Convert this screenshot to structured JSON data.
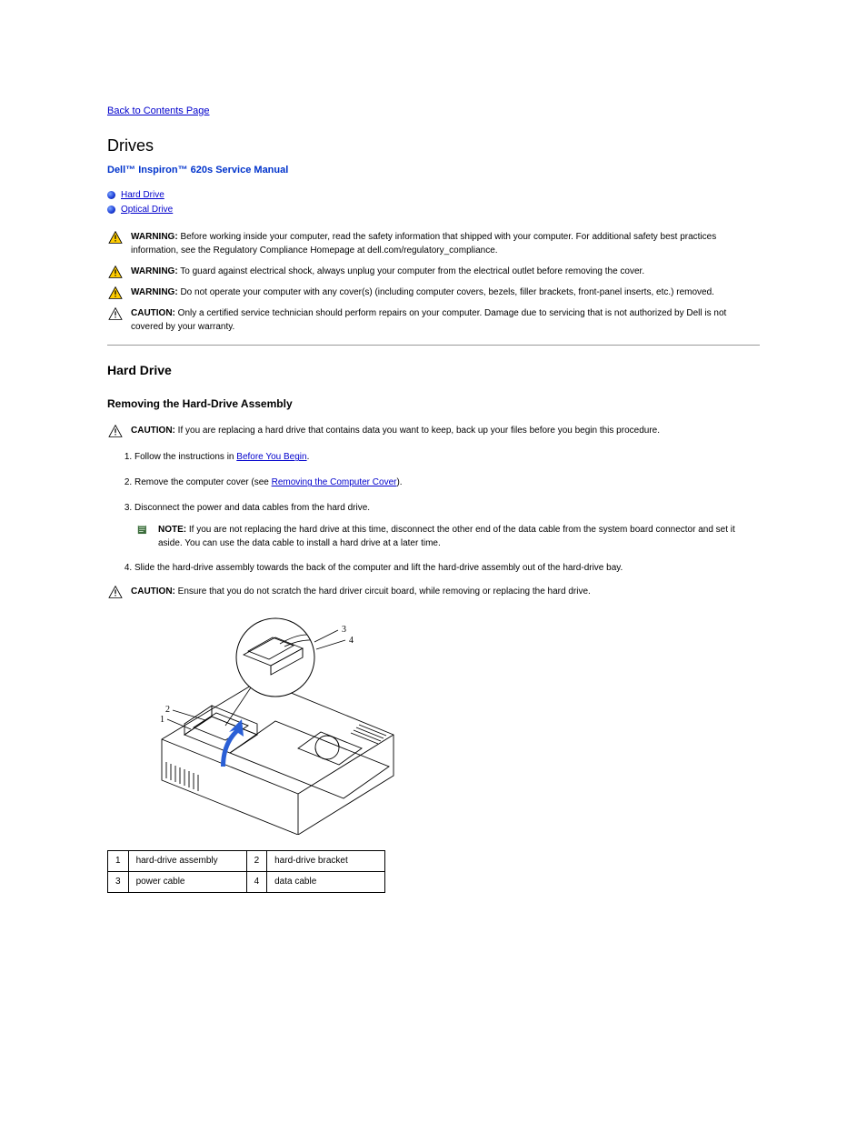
{
  "nav": {
    "back": "Back to Contents Page"
  },
  "title": "Drives",
  "manual": "Dell™ Inspiron™ 620s Service Manual",
  "toc": [
    {
      "label": "Hard Drive"
    },
    {
      "label": "Optical Drive"
    }
  ],
  "notices": {
    "warn1": {
      "lead": "WARNING:",
      "body": "Before working inside your computer, read the safety information that shipped with your computer. For additional safety best practices information, see the Regulatory Compliance Homepage at dell.com/regulatory_compliance."
    },
    "warn2": {
      "lead": "WARNING:",
      "body": "To guard against electrical shock, always unplug your computer from the electrical outlet before removing the cover."
    },
    "warn3": {
      "lead": "WARNING:",
      "body": "Do not operate your computer with any cover(s) (including computer covers, bezels, filler brackets, front-panel inserts, etc.) removed."
    },
    "caution1": {
      "lead": "CAUTION:",
      "body": "Only a certified service technician should perform repairs on your computer. Damage due to servicing that is not authorized by Dell is not covered by your warranty."
    }
  },
  "sections": {
    "hard_drive": "Hard Drive",
    "removing_assembly": "Removing the Hard-Drive Assembly"
  },
  "removal": {
    "caution_backup": {
      "lead": "CAUTION:",
      "body": "If you are replacing a hard drive that contains data you want to keep, back up your files before you begin this procedure."
    },
    "steps": [
      {
        "pre": "Follow the instructions in ",
        "link": "Before You Begin",
        "post": "."
      },
      {
        "pre": "Remove the computer cover (see ",
        "link": "Removing the Computer Cover",
        "post": ")."
      },
      {
        "plain": "Disconnect the power and data cables from the hard drive."
      },
      {
        "plain": "Slide the hard-drive assembly towards the back of the computer and lift the hard-drive assembly out of the hard-drive bay."
      }
    ],
    "note_replace": {
      "lead": "NOTE:",
      "body": "If you are not replacing the hard drive at this time, disconnect the other end of the data cable from the system board connector and set it aside. You can use the data cable to install a hard drive at a later time."
    },
    "caution_scratch": {
      "lead": "CAUTION:",
      "body": "Ensure that you do not scratch the hard driver circuit board, while removing or replacing the hard drive."
    }
  },
  "figure": {
    "labels": [
      "1",
      "2",
      "3",
      "4"
    ]
  },
  "parts_table": {
    "rows": [
      [
        "1",
        "hard-drive assembly",
        "2",
        "hard-drive bracket"
      ],
      [
        "3",
        "power cable",
        "4",
        "data cable"
      ]
    ]
  }
}
